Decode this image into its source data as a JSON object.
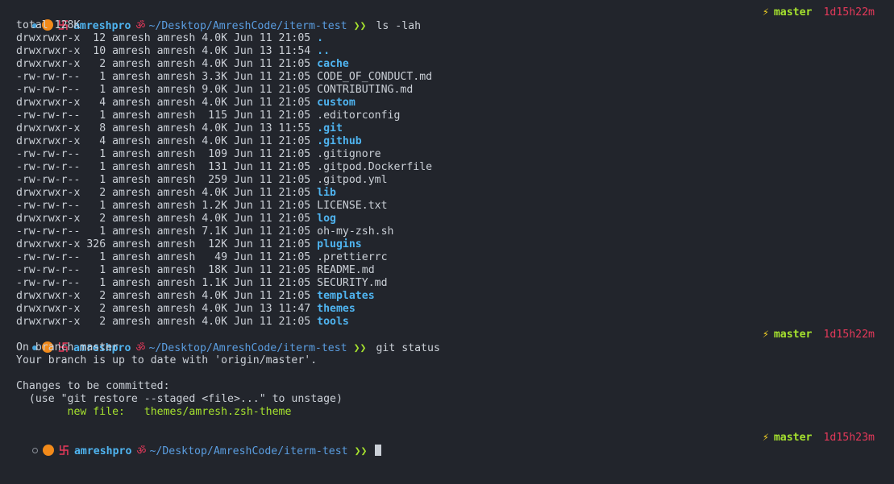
{
  "prompt": {
    "user": "amreshpro",
    "swastika": "卐",
    "om": "ॐ",
    "path": "~/Desktop/AmreshCode/iterm-test",
    "arrow": "❯❯",
    "branch_icon": "⚡",
    "branch": "master",
    "colors": {
      "user": "#4fb4f0",
      "path": "#5a9de0",
      "arrow": "#a6e22e",
      "branch": "#a6e22e",
      "time": "#e5395a",
      "bolt": "#f2d024",
      "emoji": "#f28a1a"
    }
  },
  "blocks": [
    {
      "command": "ls -lah",
      "time": "1d15h22m",
      "status_dot": "filled",
      "output": {
        "total": "total 128K",
        "entries": [
          {
            "meta": "drwxrwxr-x  12 amresh amresh 4.0K Jun 11 21:05 ",
            "name": ".",
            "is_dir": true
          },
          {
            "meta": "drwxrwxr-x  10 amresh amresh 4.0K Jun 13 11:54 ",
            "name": "..",
            "is_dir": true
          },
          {
            "meta": "drwxrwxr-x   2 amresh amresh 4.0K Jun 11 21:05 ",
            "name": "cache",
            "is_dir": true
          },
          {
            "meta": "-rw-rw-r--   1 amresh amresh 3.3K Jun 11 21:05 ",
            "name": "CODE_OF_CONDUCT.md",
            "is_dir": false
          },
          {
            "meta": "-rw-rw-r--   1 amresh amresh 9.0K Jun 11 21:05 ",
            "name": "CONTRIBUTING.md",
            "is_dir": false
          },
          {
            "meta": "drwxrwxr-x   4 amresh amresh 4.0K Jun 11 21:05 ",
            "name": "custom",
            "is_dir": true
          },
          {
            "meta": "-rw-rw-r--   1 amresh amresh  115 Jun 11 21:05 ",
            "name": ".editorconfig",
            "is_dir": false
          },
          {
            "meta": "drwxrwxr-x   8 amresh amresh 4.0K Jun 13 11:55 ",
            "name": ".git",
            "is_dir": true
          },
          {
            "meta": "drwxrwxr-x   4 amresh amresh 4.0K Jun 11 21:05 ",
            "name": ".github",
            "is_dir": true
          },
          {
            "meta": "-rw-rw-r--   1 amresh amresh  109 Jun 11 21:05 ",
            "name": ".gitignore",
            "is_dir": false
          },
          {
            "meta": "-rw-rw-r--   1 amresh amresh  131 Jun 11 21:05 ",
            "name": ".gitpod.Dockerfile",
            "is_dir": false
          },
          {
            "meta": "-rw-rw-r--   1 amresh amresh  259 Jun 11 21:05 ",
            "name": ".gitpod.yml",
            "is_dir": false
          },
          {
            "meta": "drwxrwxr-x   2 amresh amresh 4.0K Jun 11 21:05 ",
            "name": "lib",
            "is_dir": true
          },
          {
            "meta": "-rw-rw-r--   1 amresh amresh 1.2K Jun 11 21:05 ",
            "name": "LICENSE.txt",
            "is_dir": false
          },
          {
            "meta": "drwxrwxr-x   2 amresh amresh 4.0K Jun 11 21:05 ",
            "name": "log",
            "is_dir": true
          },
          {
            "meta": "-rw-rw-r--   1 amresh amresh 7.1K Jun 11 21:05 ",
            "name": "oh-my-zsh.sh",
            "is_dir": false
          },
          {
            "meta": "drwxrwxr-x 326 amresh amresh  12K Jun 11 21:05 ",
            "name": "plugins",
            "is_dir": true
          },
          {
            "meta": "-rw-rw-r--   1 amresh amresh   49 Jun 11 21:05 ",
            "name": ".prettierrc",
            "is_dir": false
          },
          {
            "meta": "-rw-rw-r--   1 amresh amresh  18K Jun 11 21:05 ",
            "name": "README.md",
            "is_dir": false
          },
          {
            "meta": "-rw-rw-r--   1 amresh amresh 1.1K Jun 11 21:05 ",
            "name": "SECURITY.md",
            "is_dir": false
          },
          {
            "meta": "drwxrwxr-x   2 amresh amresh 4.0K Jun 11 21:05 ",
            "name": "templates",
            "is_dir": true
          },
          {
            "meta": "drwxrwxr-x   2 amresh amresh 4.0K Jun 13 11:47 ",
            "name": "themes",
            "is_dir": true
          },
          {
            "meta": "drwxrwxr-x   2 amresh amresh 4.0K Jun 11 21:05 ",
            "name": "tools",
            "is_dir": true
          }
        ]
      }
    },
    {
      "command": "git status",
      "time": "1d15h22m",
      "status_dot": "filled",
      "output": {
        "lines": [
          "On branch master",
          "Your branch is up to date with 'origin/master'.",
          "",
          "Changes to be committed:",
          "  (use \"git restore --staged <file>...\" to unstage)"
        ],
        "staged_label": "        new file:   ",
        "staged_file": "themes/amresh.zsh-theme"
      }
    },
    {
      "command": "",
      "time": "1d15h23m",
      "status_dot": "hollow"
    }
  ]
}
